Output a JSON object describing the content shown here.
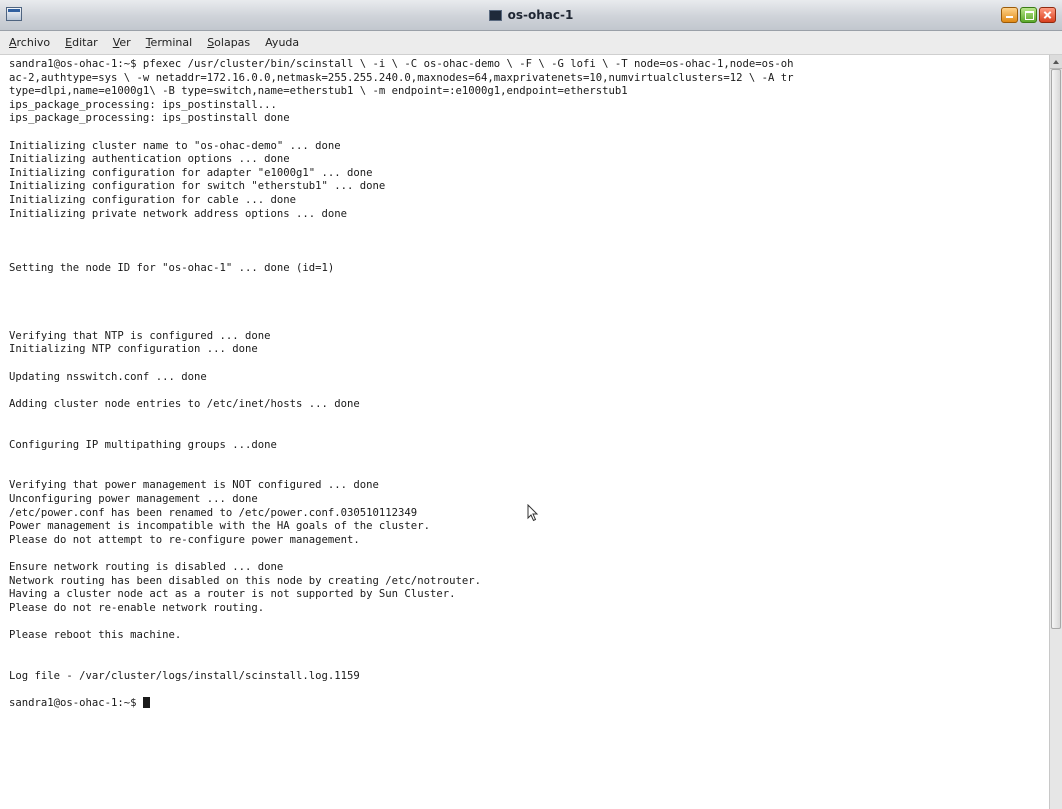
{
  "window": {
    "title": "os-ohac-1"
  },
  "menubar": {
    "items": [
      {
        "first": "A",
        "rest": "rchivo"
      },
      {
        "first": "E",
        "rest": "ditar"
      },
      {
        "first": "V",
        "rest": "er"
      },
      {
        "first": "T",
        "rest": "erminal"
      },
      {
        "first": "S",
        "rest": "olapas"
      },
      {
        "first": "",
        "rest": "Ayuda"
      }
    ]
  },
  "terminal": {
    "lines": [
      "sandra1@os-ohac-1:~$ pfexec /usr/cluster/bin/scinstall \\ -i \\ -C os-ohac-demo \\ -F \\ -G lofi \\ -T node=os-ohac-1,node=os-oh",
      "ac-2,authtype=sys \\ -w netaddr=172.16.0.0,netmask=255.255.240.0,maxnodes=64,maxprivatenets=10,numvirtualclusters=12 \\ -A tr",
      "type=dlpi,name=e1000g1\\ -B type=switch,name=etherstub1 \\ -m endpoint=:e1000g1,endpoint=etherstub1",
      "ips_package_processing: ips_postinstall...",
      "ips_package_processing: ips_postinstall done",
      "",
      "Initializing cluster name to \"os-ohac-demo\" ... done",
      "Initializing authentication options ... done",
      "Initializing configuration for adapter \"e1000g1\" ... done",
      "Initializing configuration for switch \"etherstub1\" ... done",
      "Initializing configuration for cable ... done",
      "Initializing private network address options ... done",
      "",
      "",
      "",
      "Setting the node ID for \"os-ohac-1\" ... done (id=1)",
      "",
      "",
      "",
      "",
      "Verifying that NTP is configured ... done",
      "Initializing NTP configuration ... done",
      "",
      "Updating nsswitch.conf ... done",
      "",
      "Adding cluster node entries to /etc/inet/hosts ... done",
      "",
      "",
      "Configuring IP multipathing groups ...done",
      "",
      "",
      "Verifying that power management is NOT configured ... done",
      "Unconfiguring power management ... done",
      "/etc/power.conf has been renamed to /etc/power.conf.030510112349",
      "Power management is incompatible with the HA goals of the cluster.",
      "Please do not attempt to re-configure power management.",
      "",
      "Ensure network routing is disabled ... done",
      "Network routing has been disabled on this node by creating /etc/notrouter.",
      "Having a cluster node act as a router is not supported by Sun Cluster.",
      "Please do not re-enable network routing.",
      "",
      "Please reboot this machine.",
      "",
      "",
      "Log file - /var/cluster/logs/install/scinstall.log.1159",
      "",
      "sandra1@os-ohac-1:~$ "
    ]
  },
  "colors": {
    "background": "#ffffff",
    "text": "#1a1a1a",
    "titlebar": "#cfd3d9"
  },
  "icons": [
    "window-menu-icon",
    "terminal-icon",
    "minimize-icon",
    "maximize-icon",
    "close-icon",
    "mouse-pointer-icon"
  ]
}
